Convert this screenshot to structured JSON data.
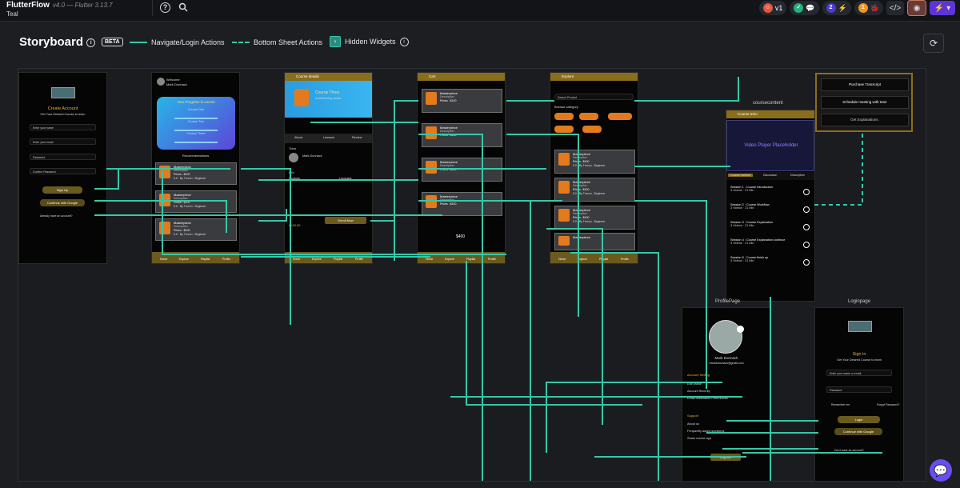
{
  "app": {
    "name": "FlutterFlow",
    "version": "v4.0",
    "flutter": "— Flutter 3.13.7",
    "project": "Teal"
  },
  "topbar": {
    "help_icon": "?",
    "search_icon": "search",
    "branch": "v1",
    "badge2": "2",
    "badge1": "1"
  },
  "storyboard": {
    "title": "Storyboard",
    "beta": "BETA",
    "legend_navigate": "Navigate/Login Actions",
    "legend_sheet": "Bottom Sheet Actions",
    "legend_hidden": "Hidden Widgets"
  },
  "screens": {
    "create_account": {
      "title": "Create Account",
      "subtitle": "Get Your Desired Course to learn",
      "fields": [
        "Enter your name",
        "Enter your email",
        "Password",
        "Confirm Password"
      ],
      "signup": "Sign Up",
      "google": "Continue with Google",
      "already": "Already have an account?"
    },
    "home": {
      "welcome": "Welcome",
      "user": "Mark Donnack",
      "progress_title": "Your Progress in course",
      "courses": [
        "Course One",
        "Course Two",
        "Course Three"
      ],
      "recommend": "Recommendations"
    },
    "course_details": {
      "header": "Course details",
      "course": "Course Three",
      "subtitle": "A full learning course",
      "tabs": [
        "About",
        "Lessons",
        "Review"
      ],
      "tutor": "Tutor",
      "tutor_name": "Mark Donnack",
      "info": "Info",
      "students": "Students",
      "language": "Language",
      "enroll": "Enroll Now",
      "price": "$100.00"
    },
    "cart": {
      "header": "Cart",
      "total": "$400"
    },
    "explore": {
      "header": "Explore",
      "search": "Search Product",
      "categories": "Browse category"
    },
    "course_content": {
      "title": "coursecontent",
      "header": "Course Intro",
      "video": "Video Player Placeholder",
      "tabs": [
        "Course Content",
        "Discussion",
        "Description"
      ],
      "sessions": [
        "Session 1 : Course Introduction",
        "Session 2 : Course Workflow",
        "Session 3 : Course Explanation",
        "Session 4 : Course Explanation continue",
        "Session 5 : Course finish up"
      ],
      "meta": "3 Videos  ·  21 Min"
    },
    "sheet": {
      "buttons": [
        "Purchase Transcript",
        "Schedule meeting with tutor",
        "Get Explanations."
      ]
    },
    "profile": {
      "title": "ProfilePage",
      "name": "Mark Donnack",
      "email": "mwarkdonnack@gmail.com",
      "section1": "Account Setting",
      "items1": [
        "Edit profile",
        "Account Security",
        "Email Notification Preferences"
      ],
      "section2": "Support",
      "items2": [
        "About us",
        "Frequently asked questions",
        "Share course app"
      ],
      "logout": "Log out"
    },
    "login": {
      "title": "Loginpage",
      "signin": "Sign in",
      "subtitle": "Get Your Desired Course to learn",
      "fields": [
        "Enter your name or email",
        "Password"
      ],
      "remember": "Remember me",
      "forgot": "Forgot Password?",
      "login": "Login",
      "google": "Continue with Google",
      "no_account": "Don't have an account?"
    }
  },
  "card": {
    "title": "Masterpiece",
    "desc": "Description:",
    "price": "Prices : $100",
    "meta": "5.0 . By Trevon . Beginner"
  },
  "nav": [
    "Home",
    "Explore",
    "Playlist",
    "Profile"
  ],
  "colors": {
    "wire": "#36c8a8",
    "gold": "#8a6d1c",
    "accent": "#5d35d6"
  }
}
